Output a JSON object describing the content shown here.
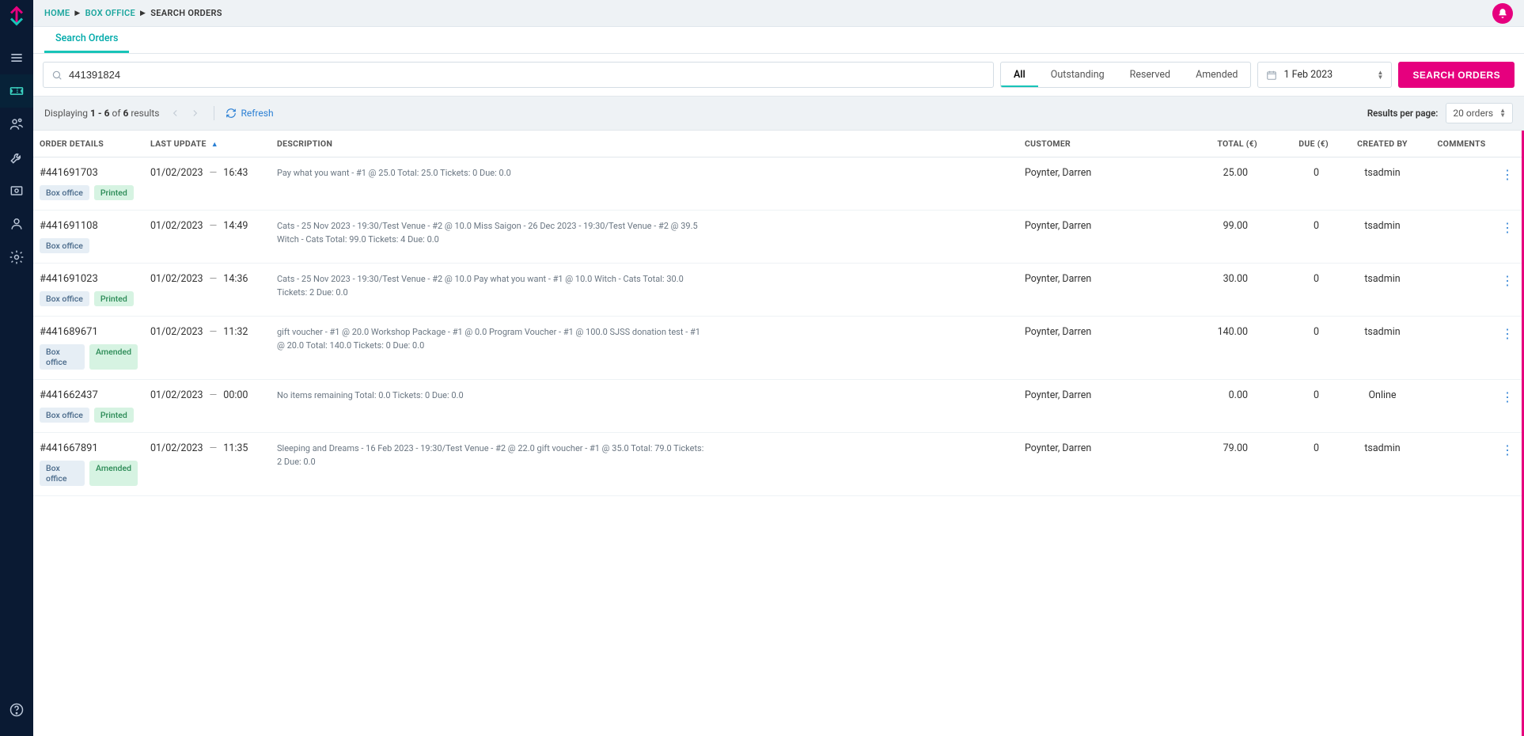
{
  "breadcrumbs": {
    "home": "HOME",
    "boxoffice": "BOX OFFICE",
    "current": "SEARCH ORDERS"
  },
  "tab": {
    "label": "Search Orders"
  },
  "search": {
    "value": "441391824",
    "filters": {
      "all": "All",
      "outstanding": "Outstanding",
      "reserved": "Reserved",
      "amended": "Amended"
    },
    "date": "1 Feb 2023",
    "button": "SEARCH ORDERS"
  },
  "toolbar": {
    "displaying_prefix": "Displaying ",
    "range": "1 - 6",
    "of_word": " of ",
    "total": "6",
    "results_word": " results",
    "refresh": "Refresh",
    "rpp_label": "Results per page:",
    "rpp_value": "20 orders"
  },
  "columns": {
    "order_details": "ORDER DETAILS",
    "last_update": "LAST UPDATE",
    "description": "DESCRIPTION",
    "customer": "CUSTOMER",
    "total": "TOTAL (€)",
    "due": "DUE (€)",
    "created_by": "CREATED BY",
    "comments": "COMMENTS"
  },
  "badge_labels": {
    "box_office": "Box office",
    "printed": "Printed",
    "amended": "Amended"
  },
  "rows": [
    {
      "id": "#441691703",
      "date": "01/02/2023",
      "time": "16:43",
      "desc": "Pay what you want - #1 @ 25.0 Total: 25.0 Tickets: 0 Due: 0.0",
      "customer": "Poynter, Darren",
      "total": "25.00",
      "due": "0",
      "created_by": "tsadmin",
      "badges": [
        "box_office",
        "printed"
      ]
    },
    {
      "id": "#441691108",
      "date": "01/02/2023",
      "time": "14:49",
      "desc": "Cats - 25 Nov 2023 - 19:30/Test Venue - #2 @ 10.0 Miss Saigon - 26 Dec 2023 - 19:30/Test Venue - #2 @ 39.5 Witch - Cats Total: 99.0 Tickets: 4 Due: 0.0",
      "customer": "Poynter, Darren",
      "total": "99.00",
      "due": "0",
      "created_by": "tsadmin",
      "badges": [
        "box_office"
      ]
    },
    {
      "id": "#441691023",
      "date": "01/02/2023",
      "time": "14:36",
      "desc": "Cats - 25 Nov 2023 - 19:30/Test Venue - #2 @ 10.0 Pay what you want - #1 @ 10.0 Witch - Cats Total: 30.0 Tickets: 2 Due: 0.0",
      "customer": "Poynter, Darren",
      "total": "30.00",
      "due": "0",
      "created_by": "tsadmin",
      "badges": [
        "box_office",
        "printed"
      ]
    },
    {
      "id": "#441689671",
      "date": "01/02/2023",
      "time": "11:32",
      "desc": "gift voucher - #1 @ 20.0 Workshop Package - #1 @ 0.0 Program Voucher - #1 @ 100.0 SJSS donation test - #1 @ 20.0 Total: 140.0 Tickets: 0 Due: 0.0",
      "customer": "Poynter, Darren",
      "total": "140.00",
      "due": "0",
      "created_by": "tsadmin",
      "badges": [
        "box_office",
        "amended"
      ]
    },
    {
      "id": "#441662437",
      "date": "01/02/2023",
      "time": "00:00",
      "desc": "No items remaining Total: 0.0 Tickets: 0 Due: 0.0",
      "customer": "Poynter, Darren",
      "total": "0.00",
      "due": "0",
      "created_by": "Online",
      "badges": [
        "box_office",
        "printed"
      ]
    },
    {
      "id": "#441667891",
      "date": "01/02/2023",
      "time": "11:35",
      "desc": "Sleeping and Dreams - 16 Feb 2023 - 19:30/Test Venue - #2 @ 22.0 gift voucher - #1 @ 35.0 Total: 79.0 Tickets: 2 Due: 0.0",
      "customer": "Poynter, Darren",
      "total": "79.00",
      "due": "0",
      "created_by": "tsadmin",
      "badges": [
        "box_office",
        "amended"
      ]
    }
  ]
}
